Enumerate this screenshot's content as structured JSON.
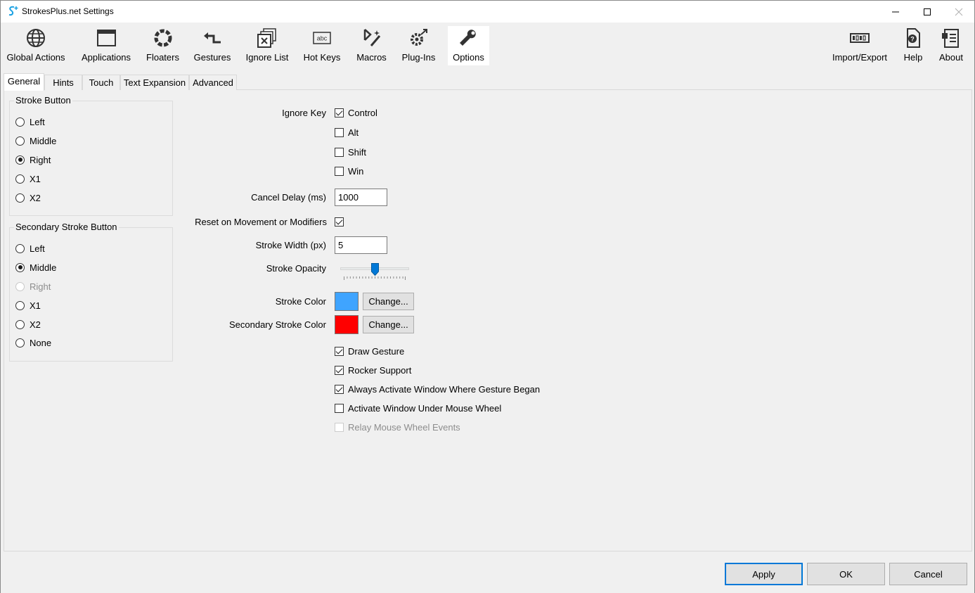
{
  "window": {
    "title": "StrokesPlus.net Settings"
  },
  "toolbar": {
    "items": [
      {
        "label": "Global Actions",
        "icon": "globe-icon"
      },
      {
        "label": "Applications",
        "icon": "application-window-icon"
      },
      {
        "label": "Floaters",
        "icon": "floaters-icon"
      },
      {
        "label": "Gestures",
        "icon": "gesture-arrow-icon"
      },
      {
        "label": "Ignore List",
        "icon": "ignore-list-icon"
      },
      {
        "label": "Hot Keys",
        "icon": "hotkeys-keyboard-icon"
      },
      {
        "label": "Macros",
        "icon": "macro-wand-icon"
      },
      {
        "label": "Plug-Ins",
        "icon": "plugin-gear-icon"
      },
      {
        "label": "Options",
        "icon": "wrench-icon"
      }
    ],
    "right_items": [
      {
        "label": "Import/Export",
        "icon": "import-export-icon"
      },
      {
        "label": "Help",
        "icon": "help-document-icon"
      },
      {
        "label": "About",
        "icon": "about-document-icon"
      }
    ],
    "active": "Options"
  },
  "tabs": [
    "General",
    "Hints",
    "Touch",
    "Text Expansion",
    "Advanced"
  ],
  "active_tab": "General",
  "stroke_button": {
    "title": "Stroke Button",
    "options": [
      {
        "label": "Left",
        "checked": false,
        "disabled": false
      },
      {
        "label": "Middle",
        "checked": false,
        "disabled": false
      },
      {
        "label": "Right",
        "checked": true,
        "disabled": false
      },
      {
        "label": "X1",
        "checked": false,
        "disabled": false
      },
      {
        "label": "X2",
        "checked": false,
        "disabled": false
      }
    ]
  },
  "secondary_stroke_button": {
    "title": "Secondary Stroke Button",
    "options": [
      {
        "label": "Left",
        "checked": false,
        "disabled": false
      },
      {
        "label": "Middle",
        "checked": true,
        "disabled": false
      },
      {
        "label": "Right",
        "checked": false,
        "disabled": true
      },
      {
        "label": "X1",
        "checked": false,
        "disabled": false
      },
      {
        "label": "X2",
        "checked": false,
        "disabled": false
      },
      {
        "label": "None",
        "checked": false,
        "disabled": false
      }
    ]
  },
  "general": {
    "ignore_key_label": "Ignore Key",
    "ignore_keys": [
      {
        "label": "Control",
        "checked": true
      },
      {
        "label": "Alt",
        "checked": false
      },
      {
        "label": "Shift",
        "checked": false
      },
      {
        "label": "Win",
        "checked": false
      }
    ],
    "cancel_delay_label": "Cancel Delay (ms)",
    "cancel_delay_value": "1000",
    "reset_label": "Reset on Movement or Modifiers",
    "reset_checked": true,
    "stroke_width_label": "Stroke Width (px)",
    "stroke_width_value": "5",
    "stroke_opacity_label": "Stroke Opacity",
    "stroke_opacity_fraction": 0.5,
    "stroke_color_label": "Stroke Color",
    "stroke_color": "#3fa4ff",
    "secondary_stroke_color_label": "Secondary Stroke Color",
    "secondary_stroke_color": "#ff0000",
    "change_label": "Change...",
    "options": [
      {
        "label": "Draw Gesture",
        "checked": true,
        "disabled": false
      },
      {
        "label": "Rocker Support",
        "checked": true,
        "disabled": false
      },
      {
        "label": "Always Activate Window Where Gesture Began",
        "checked": true,
        "disabled": false
      },
      {
        "label": "Activate Window Under Mouse Wheel",
        "checked": false,
        "disabled": false
      },
      {
        "label": "Relay Mouse Wheel Events",
        "checked": false,
        "disabled": true
      }
    ]
  },
  "footer": {
    "apply": "Apply",
    "ok": "OK",
    "cancel": "Cancel"
  },
  "colors": {
    "accent": "#0078d7"
  }
}
